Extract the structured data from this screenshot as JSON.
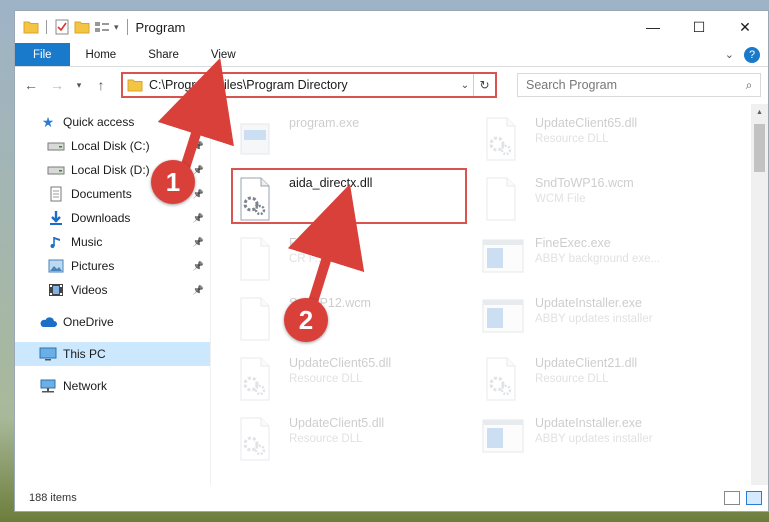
{
  "window": {
    "title": "Program"
  },
  "ribbon": {
    "tabs": [
      "File",
      "Home",
      "Share",
      "View"
    ]
  },
  "address": {
    "path": "C:\\Program Files\\Program Directory"
  },
  "search": {
    "placeholder": "Search Program"
  },
  "nav": {
    "quick_access": "Quick access",
    "pinned": [
      {
        "label": "Local Disk (C:)",
        "icon": "drive-icon"
      },
      {
        "label": "Local Disk (D:)",
        "icon": "drive-icon"
      },
      {
        "label": "Documents",
        "icon": "documents-icon"
      },
      {
        "label": "Downloads",
        "icon": "downloads-icon"
      },
      {
        "label": "Music",
        "icon": "music-icon"
      },
      {
        "label": "Pictures",
        "icon": "pictures-icon"
      },
      {
        "label": "Videos",
        "icon": "videos-icon"
      }
    ],
    "onedrive": "OneDrive",
    "thispc": "This PC",
    "network": "Network"
  },
  "files": [
    {
      "name": "program.exe",
      "type": "",
      "icon": "exe-icon",
      "faded": true
    },
    {
      "name": "UpdateClient65.dll",
      "type": "Resource DLL",
      "icon": "dll-icon",
      "faded": true
    },
    {
      "name": "aida_directx.dll",
      "type": "",
      "icon": "dll-icon",
      "faded": false
    },
    {
      "name": "SndToWP16.wcm",
      "type": "WCM File",
      "icon": "file-icon",
      "faded": true
    },
    {
      "name": "FastRe...k",
      "type": "CR F...",
      "icon": "file-icon",
      "faded": true
    },
    {
      "name": "FineExec.exe",
      "type": "ABBY background exe...",
      "icon": "app-window-icon",
      "faded": true
    },
    {
      "name": "S...WP12.wcm",
      "type": "...e",
      "icon": "file-icon",
      "faded": true
    },
    {
      "name": "UpdateInstaller.exe",
      "type": "ABBY updates installer",
      "icon": "app-window-icon",
      "faded": true
    },
    {
      "name": "UpdateClient65.dll",
      "type": "Resource DLL",
      "icon": "dll-icon",
      "faded": true
    },
    {
      "name": "UpdateClient21.dll",
      "type": "Resource DLL",
      "icon": "dll-icon",
      "faded": true
    },
    {
      "name": "UpdateClient5.dll",
      "type": "Resource DLL",
      "icon": "dll-icon",
      "faded": true
    },
    {
      "name": "UpdateInstaller.exe",
      "type": "ABBY updates installer",
      "icon": "app-window-icon",
      "faded": true
    }
  ],
  "status": {
    "items": "188 items"
  },
  "callouts": [
    "1",
    "2"
  ],
  "colors": {
    "accent": "#1979ca",
    "annotation": "#d9403a",
    "selection": "#cce8ff"
  }
}
